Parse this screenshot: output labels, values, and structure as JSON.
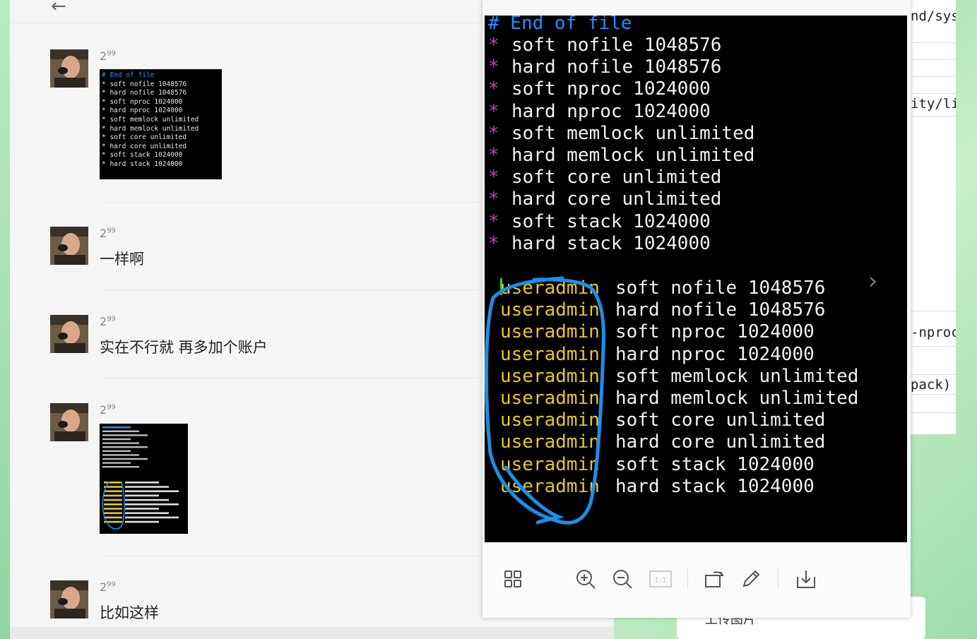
{
  "chat": {
    "back_icon": "arrow-left-icon",
    "messages": [
      {
        "name": "2",
        "name_sup": "99",
        "type": "image"
      },
      {
        "name": "2",
        "name_sup": "99",
        "type": "text",
        "text": "一样啊"
      },
      {
        "name": "2",
        "name_sup": "99",
        "type": "text",
        "text": "实在不行就 再多加个账户"
      },
      {
        "name": "2",
        "name_sup": "99",
        "type": "image"
      },
      {
        "name": "2",
        "name_sup": "99",
        "type": "text",
        "text": "比如这样"
      }
    ]
  },
  "thumb1_lines": [
    "# End of file",
    "* soft nofile 1048576",
    "* hard nofile 1048576",
    "* soft nproc 1024000",
    "* hard nproc 1024000",
    "* soft memlock unlimited",
    "* hard memlock unlimited",
    "* soft core unlimited",
    "* hard core unlimited",
    "* soft stack 1024000",
    "* hard stack 1024000"
  ],
  "viewer": {
    "comment_line": "# End of file",
    "star_lines": [
      "soft nofile 1048576",
      "hard nofile 1048576",
      "soft nproc 1024000",
      "hard nproc 1024000",
      "soft memlock unlimited",
      "hard memlock unlimited",
      "soft core unlimited",
      "hard core unlimited",
      "soft stack 1024000",
      "hard stack 1024000"
    ],
    "user_lines": [
      {
        "user": "useradmin",
        "rest": "soft nofile 1048576"
      },
      {
        "user": "useradmin",
        "rest": "hard nofile 1048576"
      },
      {
        "user": "useradmin",
        "rest": "soft nproc 1024000"
      },
      {
        "user": "useradmin",
        "rest": "hard nproc 1024000"
      },
      {
        "user": "useradmin",
        "rest": "soft memlock unlimited"
      },
      {
        "user": "useradmin",
        "rest": "hard memlock unlimited"
      },
      {
        "user": "useradmin",
        "rest": "soft core unlimited"
      },
      {
        "user": "useradmin",
        "rest": "hard core unlimited"
      },
      {
        "user": "useradmin",
        "rest": "soft stack 1024000"
      },
      {
        "user": "useradmin",
        "rest": "hard stack 1024000"
      }
    ],
    "annotation_color": "#1a8fe8",
    "toolbar": [
      "grid-view-icon",
      "zoom-in-icon",
      "zoom-out-icon",
      "actual-size-icon",
      "rotate-icon",
      "edit-pen-icon",
      "download-icon"
    ],
    "actual_size_label": "1:1"
  },
  "right_doc": {
    "snippets": [
      "nd/sys",
      "ity/li",
      "-nproc",
      "pack)"
    ]
  },
  "upload_card": {
    "label": "上传图片"
  }
}
